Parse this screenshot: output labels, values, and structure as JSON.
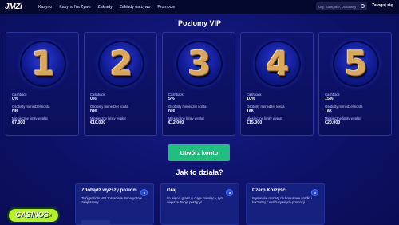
{
  "header": {
    "logo": "JMZi",
    "nav": [
      "Kasyno",
      "Kasyno Na Żywo",
      "Zakłady",
      "Zakłady na żywo",
      "Promocje"
    ],
    "search_placeholder": "Gry, Kategorie, Dostawcy",
    "login_label": "Zaloguj się"
  },
  "main": {
    "title": "Poziomy VIP",
    "levels": [
      {
        "number": "1",
        "cashback_label": "Cashback",
        "cashback": "0%",
        "manager_label": "Osobisty menedżer konta",
        "manager": "Nie",
        "limits_label": "Miesięczne limity wypłat",
        "limits": "€7,000"
      },
      {
        "number": "2",
        "cashback_label": "Cashback",
        "cashback": "0%",
        "manager_label": "Osobisty menedżer konta",
        "manager": "Nie",
        "limits_label": "Miesięczne limity wypłat",
        "limits": "€10,000"
      },
      {
        "number": "3",
        "cashback_label": "Cashback",
        "cashback": "5%",
        "manager_label": "Osobisty menedżer konta",
        "manager": "Nie",
        "limits_label": "Miesięczne limity wypłat",
        "limits": "€12,000"
      },
      {
        "number": "4",
        "cashback_label": "Cashback",
        "cashback": "10%",
        "manager_label": "Osobisty menedżer konta",
        "manager": "Tak",
        "limits_label": "Miesięczne limity wypłat",
        "limits": "€15,000"
      },
      {
        "number": "5",
        "cashback_label": "Cashback",
        "cashback": "15%",
        "manager_label": "Osobisty menedżer konta",
        "manager": "Tak",
        "limits_label": "Miesięczne limity wypłat",
        "limits": "€20,000"
      }
    ],
    "cta_label": "Utwórz konto",
    "how_title": "Jak to działa?",
    "info_cards": [
      {
        "title": "Zdobądź wyższy poziom",
        "text": "Twój poziom VIP zostanie automatycznie zwiększony."
      },
      {
        "title": "Graj",
        "text": "Im więcej grasz w ciągu miesiąca, tym większe Twoje postępy!"
      },
      {
        "title": "Czerp Korzyści",
        "text": "Wymieniaj monety na bonusowe środki i korzystaj z ekskluzywnych promocji."
      }
    ]
  },
  "watermark": {
    "text": "CASINOS",
    "suffix": "pl"
  },
  "colors": {
    "background": "#0d1166",
    "topbar": "#05082e",
    "cta": "#1fbf7e",
    "medal_gold": "#d9a85a"
  }
}
